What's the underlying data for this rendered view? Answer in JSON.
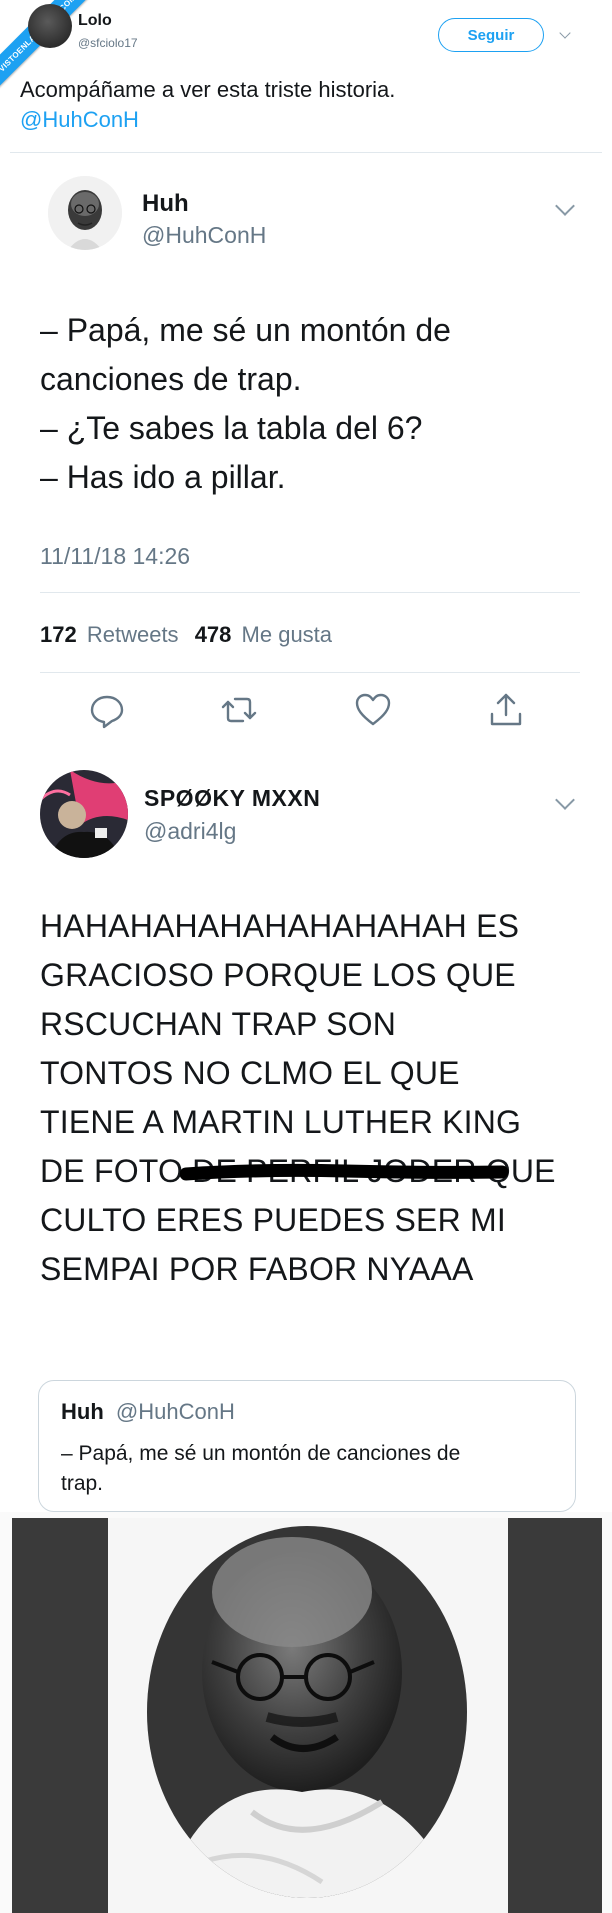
{
  "watermark": "VISTOENLASREDES.COM",
  "top": {
    "name": "Lolo",
    "handle": "@sfciolo17",
    "follow_label": "Seguir",
    "text_line1": "Acompáñame a ver esta triste historia.",
    "mention": "@HuhConH"
  },
  "main": {
    "name": "Huh",
    "handle": "@HuhConH",
    "lines": [
      "– Papá, me sé un montón de",
      "canciones de trap.",
      "– ¿Te sabes la tabla del 6?",
      "– Has ido a pillar."
    ],
    "timestamp": "11/11/18 14:26",
    "retweets_count": "172",
    "retweets_label": "Retweets",
    "likes_count": "478",
    "likes_label": "Me gusta"
  },
  "reply": {
    "name": "SPØØKY MXXN",
    "handle": "@adri4lg",
    "lines": [
      "HAHAHAHAHAHAHAHAHAH ES",
      "GRACIOSO PORQUE LOS QUE",
      "RSCUCHAN TRAP SON",
      "TONTOS NO CLMO EL QUE",
      "TIENE A MARTIN LUTHER KING",
      "DE FOTO DE PERFIL JODER QUE",
      "CULTO ERES PUEDES SER MI",
      "SEMPAI POR FABOR NYAAA"
    ],
    "quote": {
      "name": "Huh",
      "handle": "@HuhConH",
      "line1": "– Papá, me sé un montón de canciones de",
      "line2": "trap."
    }
  },
  "colors": {
    "accent": "#1da1f2",
    "text": "#14171a",
    "muted": "#657786",
    "divider": "#e1e8ed",
    "watermark_bg": "#1da1f2",
    "photo_side": "#3a3a3a"
  }
}
